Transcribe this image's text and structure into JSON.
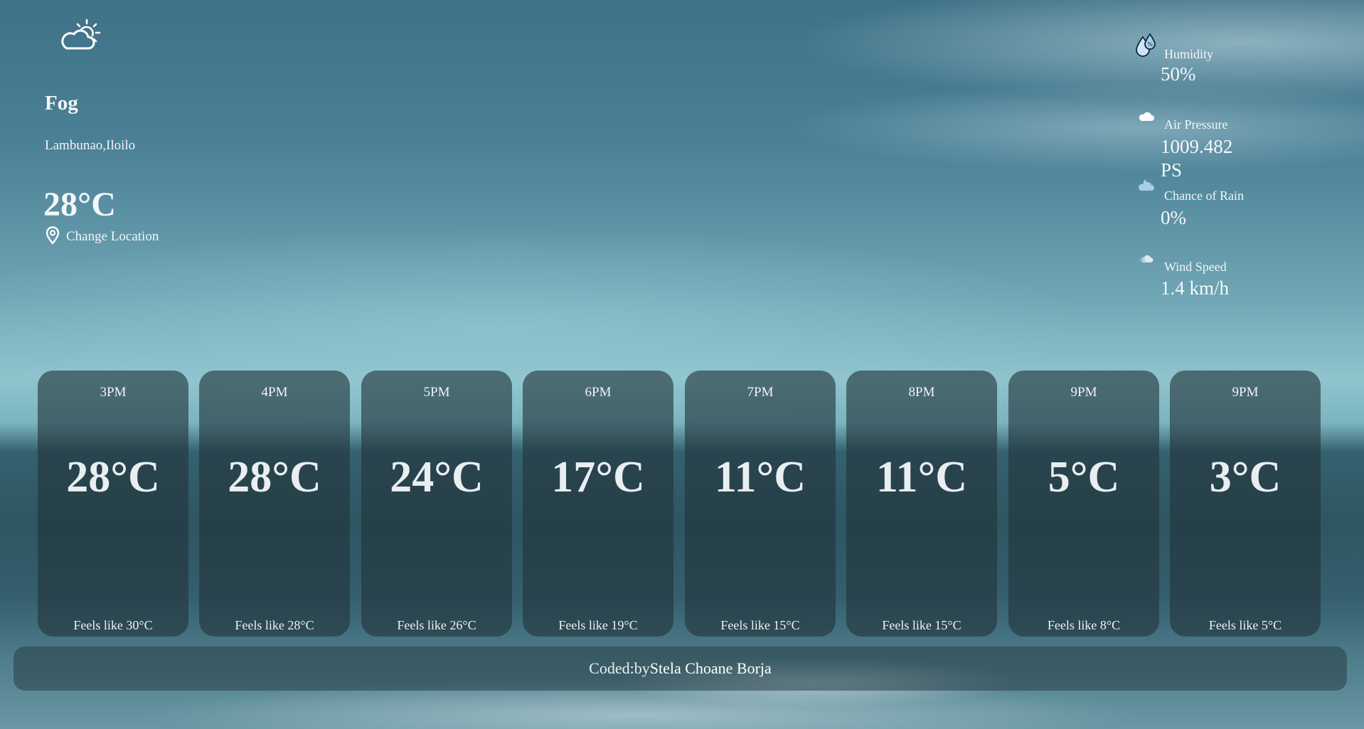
{
  "current": {
    "icon": "partly-cloudy-day-icon",
    "condition": "Fog",
    "location": "Lambunao,Iloilo",
    "temperature": "28°C",
    "change_location_label": "Change Location"
  },
  "details": [
    {
      "icon": "humidity-drop-icon",
      "label": "Humidity",
      "value": "50%"
    },
    {
      "icon": "cloud-icon",
      "label": "Air Pressure",
      "value": "1009.482 PS"
    },
    {
      "icon": "rain-cloud-icon",
      "label": "Chance of Rain",
      "value": "0%"
    },
    {
      "icon": "wind-icon",
      "label": "Wind Speed",
      "value": "1.4 km/h"
    }
  ],
  "hourly": [
    {
      "time": "3PM",
      "temp": "28°C",
      "feels": "Feels like 30°C"
    },
    {
      "time": "4PM",
      "temp": "28°C",
      "feels": "Feels like 28°C"
    },
    {
      "time": "5PM",
      "temp": "24°C",
      "feels": "Feels like 26°C"
    },
    {
      "time": "6PM",
      "temp": "17°C",
      "feels": "Feels like 19°C"
    },
    {
      "time": "7PM",
      "temp": "11°C",
      "feels": "Feels like 15°C"
    },
    {
      "time": "8PM",
      "temp": "11°C",
      "feels": "Feels like 15°C"
    },
    {
      "time": "9PM",
      "temp": "5°C",
      "feels": "Feels like 8°C"
    },
    {
      "time": "9PM",
      "temp": "3°C",
      "feels": "Feels like 5°C"
    }
  ],
  "footer": {
    "prefix": "Coded:by",
    "author": "Stela Choane Borja"
  }
}
